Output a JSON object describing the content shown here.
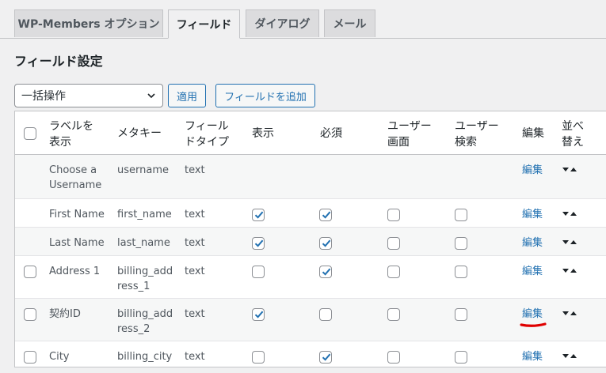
{
  "tabs": [
    {
      "label": "WP-Members オプション"
    },
    {
      "label": "フィールド"
    },
    {
      "label": "ダイアログ"
    },
    {
      "label": "メール"
    }
  ],
  "page_title": "フィールド設定",
  "bulk": {
    "selected": "一括操作",
    "apply_label": "適用",
    "add_field_label": "フィールドを追加"
  },
  "table": {
    "headers": {
      "label": [
        "ラベルを",
        "表示"
      ],
      "meta_key": "メタキー",
      "field_type": [
        "フィール",
        "ドタイプ"
      ],
      "display": "表示",
      "required": "必須",
      "user_screen": [
        "ユーザー",
        "画面"
      ],
      "user_search": [
        "ユーザー",
        "検索"
      ],
      "edit": "編集",
      "sort": [
        "並べ",
        "替え"
      ]
    },
    "rows": [
      {
        "label": [
          "Choose a",
          "Username"
        ],
        "meta_key": [
          "username"
        ],
        "type": "text",
        "has_select": false,
        "display": null,
        "required": null,
        "user_screen": null,
        "user_search": null,
        "edit": "編集"
      },
      {
        "label": [
          "First Name"
        ],
        "meta_key": [
          "first_name"
        ],
        "type": "text",
        "has_select": false,
        "display": true,
        "required": true,
        "user_screen": false,
        "user_search": false,
        "edit": "編集"
      },
      {
        "label": [
          "Last Name"
        ],
        "meta_key": [
          "last_name"
        ],
        "type": "text",
        "has_select": false,
        "display": true,
        "required": true,
        "user_screen": false,
        "user_search": false,
        "edit": "編集"
      },
      {
        "label": [
          "Address 1"
        ],
        "meta_key": [
          "billing_add",
          "ress_1"
        ],
        "type": "text",
        "has_select": true,
        "display": false,
        "required": true,
        "user_screen": false,
        "user_search": false,
        "edit": "編集"
      },
      {
        "label": [
          "契約ID"
        ],
        "meta_key": [
          "billing_add",
          "ress_2"
        ],
        "type": "text",
        "has_select": true,
        "display": true,
        "required": false,
        "user_screen": false,
        "user_search": false,
        "edit": "編集",
        "annotated": true
      },
      {
        "label": [
          "City"
        ],
        "meta_key": [
          "billing_city"
        ],
        "type": "text",
        "has_select": true,
        "display": false,
        "required": true,
        "user_screen": false,
        "user_search": false,
        "edit": "編集"
      }
    ]
  },
  "colors": {
    "link": "#2271b1",
    "annotation": "#e00000"
  }
}
